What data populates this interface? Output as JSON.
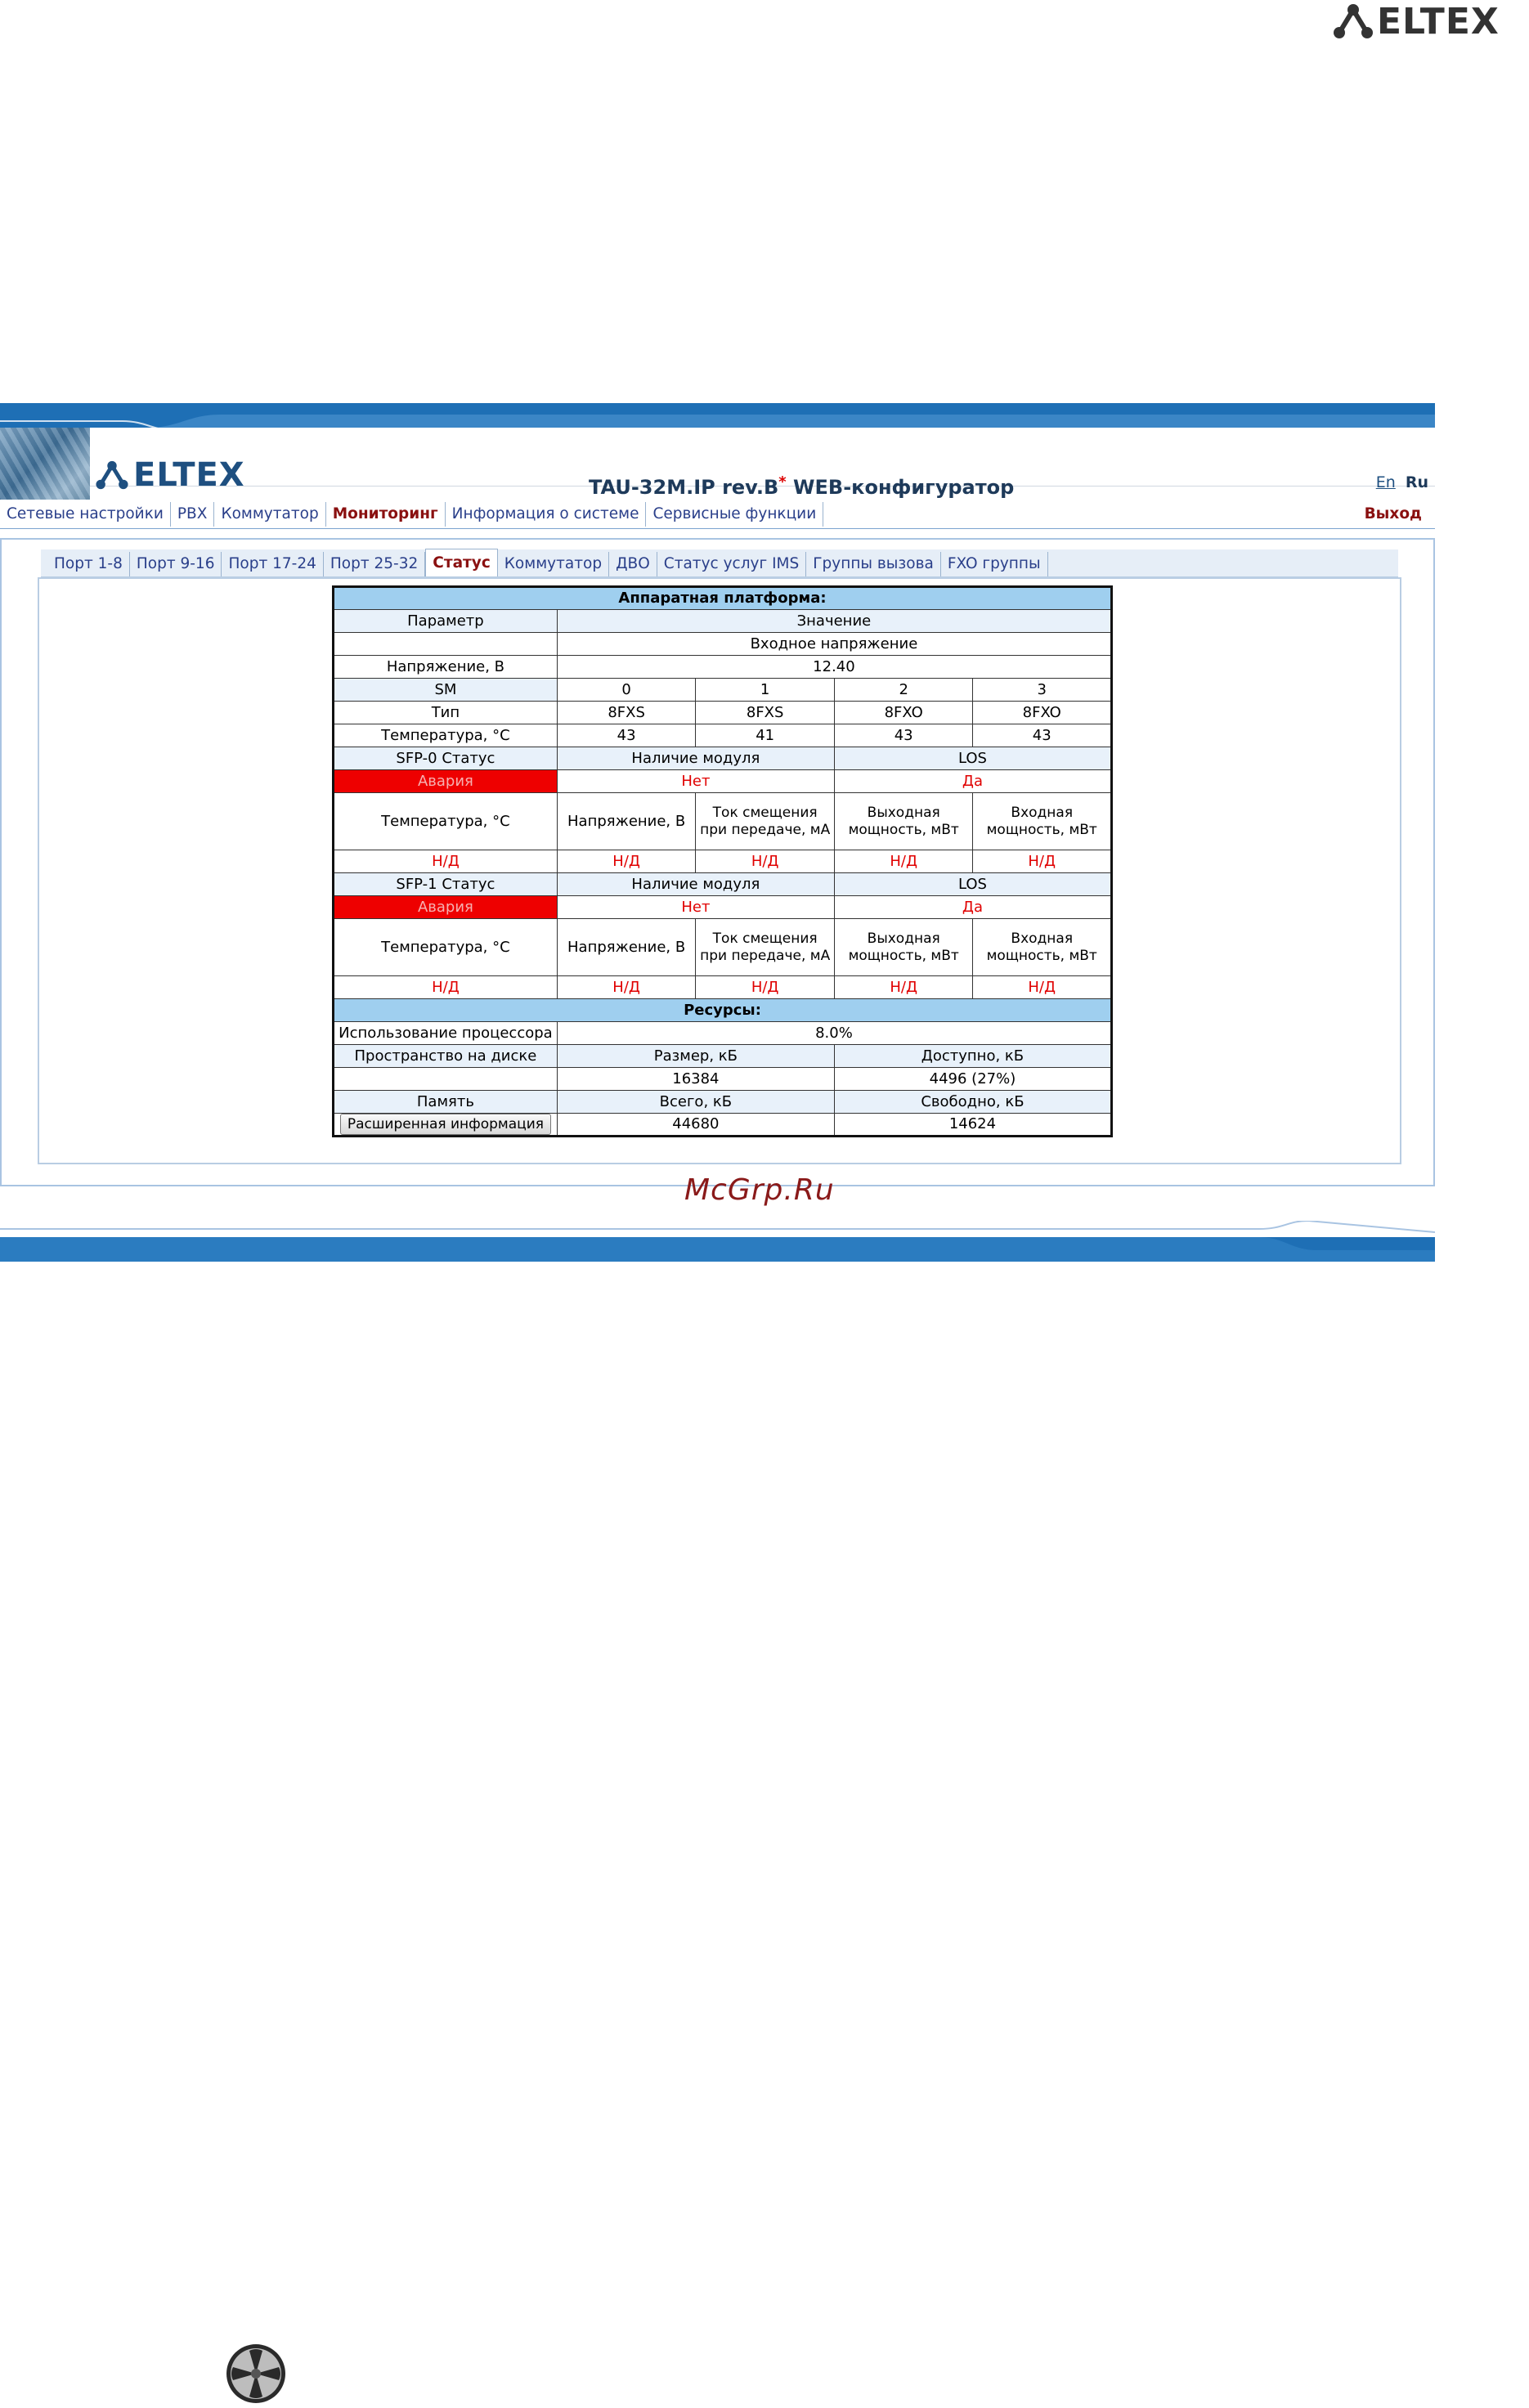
{
  "corner_logo": {
    "text": "ELTEX"
  },
  "header": {
    "logo_text": "ELTEX",
    "title": "TAU-32M.IP rev.B",
    "title_mark": "*",
    "title_suffix": " WEB-конфигуратор",
    "lang_en": "En",
    "lang_ru": "Ru"
  },
  "menu": {
    "items": [
      "Сетевые настройки",
      "PBX",
      "Коммутатор",
      "Мониторинг",
      "Информация о системе",
      "Сервисные функции"
    ],
    "active": "Мониторинг",
    "logout": "Выход"
  },
  "subtabs": {
    "items": [
      "Порт 1-8",
      "Порт 9-16",
      "Порт 17-24",
      "Порт 25-32",
      "Статус",
      "Коммутатор",
      "ДВО",
      "Статус услуг IMS",
      "Группы вызова",
      "FXO группы"
    ],
    "active": "Статус"
  },
  "status": {
    "hw_title": "Аппаратная платформа:",
    "param": "Параметр",
    "value": "Значение",
    "input_voltage": "Входное напряжение",
    "voltage_label": "Напряжение, В",
    "voltage_value": "12.40",
    "sm_label": "SM",
    "sm": [
      "0",
      "1",
      "2",
      "3"
    ],
    "type_label": "Тип",
    "types": [
      "8FXS",
      "8FXS",
      "8FXO",
      "8FXO"
    ],
    "temp_label": "Температура, °С",
    "temps": [
      "43",
      "41",
      "43",
      "43"
    ],
    "sfp0_status": "SFP-0 Статус",
    "sfp1_status": "SFP-1 Статус",
    "module_presence": "Наличие модуля",
    "los": "LOS",
    "alarm": "Авария",
    "no": "Нет",
    "yes": "Да",
    "sfp_temp": "Температура, °С",
    "sfp_voltage": "Напряжение, В",
    "sfp_bias": "Ток смещения при передаче, мА",
    "sfp_out": "Выходная мощность, мВт",
    "sfp_in": "Входная мощность, мВт",
    "na": "Н/Д",
    "res_title": "Ресурсы:",
    "cpu_label": "Использование процессора",
    "cpu_value": "8.0%",
    "disk_label": "Пространство на диске",
    "disk_size_label": "Размер, кБ",
    "disk_free_label": "Доступно, кБ",
    "disk_size": "16384",
    "disk_free": "4496 (27%)",
    "mem_label": "Память",
    "mem_total_label": "Всего, кБ",
    "mem_free_label": "Свободно, кБ",
    "more_button": "Расширенная информация",
    "mem_total": "44680",
    "mem_free": "14624"
  },
  "watermark": "McGrp.Ru",
  "colors": {
    "accent": "#1e6fb5",
    "alarm": "#ee0000",
    "section": "#9fcfef"
  }
}
